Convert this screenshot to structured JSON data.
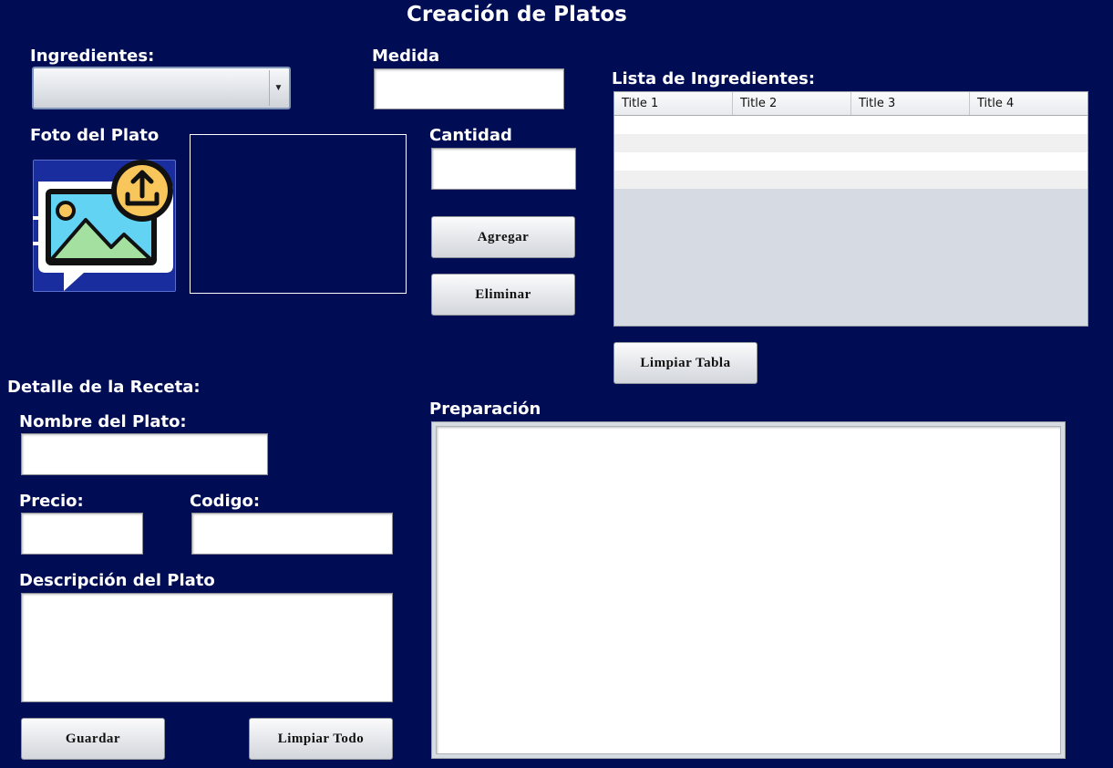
{
  "window": {
    "title": "Creación de Platos"
  },
  "ingredients_section": {
    "ingredientes_label": "Ingredientes:",
    "ingredientes_selected": "",
    "medida_label": "Medida",
    "medida_value": "",
    "cantidad_label": "Cantidad",
    "cantidad_value": "",
    "foto_label": "Foto del Plato",
    "agregar_label": "Agregar",
    "eliminar_label": "Eliminar"
  },
  "ingredients_list": {
    "label": "Lista de Ingredientes:",
    "columns": [
      "Title 1",
      "Title 2",
      "Title 3",
      "Title 4"
    ],
    "limpiar_tabla_label": "Limpiar Tabla"
  },
  "recipe": {
    "section_label": "Detalle de la Receta:",
    "nombre_label": "Nombre del Plato:",
    "nombre_value": "",
    "precio_label": "Precio:",
    "precio_value": "",
    "codigo_label": "Codigo:",
    "codigo_value": "",
    "descripcion_label": "Descripción del Plato",
    "descripcion_value": "",
    "preparacion_label": "Preparación",
    "preparacion_value": "",
    "guardar_label": "Guardar",
    "limpiar_todo_label": "Limpiar Todo"
  },
  "colors": {
    "background": "#000d55",
    "upload_icon_badge": "#f9c65c",
    "upload_icon_sky": "#63d3f4",
    "upload_icon_hills": "#a4e0a0"
  },
  "icons": {
    "upload": "image-upload-icon"
  }
}
